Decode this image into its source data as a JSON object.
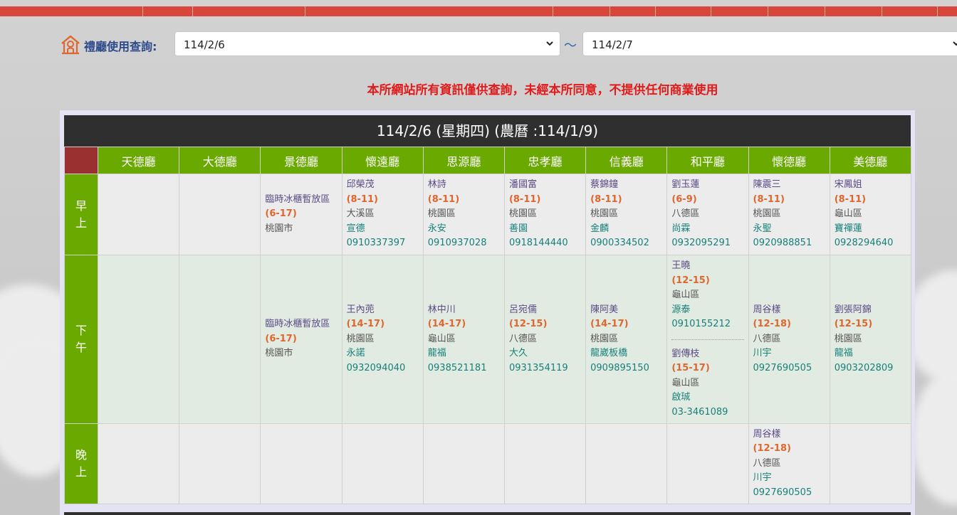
{
  "search": {
    "label": "禮廳使用查詢:",
    "start_date": "114/2/6",
    "end_date": "114/2/7",
    "separator": "〜"
  },
  "notice": "本所網站所有資訊僅供查詢，未經本所同意，不提供任何商業使用",
  "day": {
    "title": "114/2/6 (星期四) (農曆 :114/1/9)",
    "halls": [
      "天德廳",
      "大德廳",
      "景德廳",
      "懷遠廳",
      "思源廳",
      "忠孝廳",
      "信義廳",
      "和平廳",
      "懷德廳",
      "美德廳"
    ],
    "periods": [
      {
        "label": "早上",
        "cells": [
          [],
          [],
          [
            {
              "name": "臨時冰櫃暫放區",
              "time": "(6-17)",
              "area": "桃園市",
              "op": "",
              "phone": ""
            }
          ],
          [
            {
              "name": "邱榮茂",
              "time": "(8-11)",
              "area": "大溪區",
              "op": "宣德",
              "phone": "0910337397"
            }
          ],
          [
            {
              "name": "林詩",
              "time": "(8-11)",
              "area": "桃園區",
              "op": "永安",
              "phone": "0910937028"
            }
          ],
          [
            {
              "name": "潘國富",
              "time": "(8-11)",
              "area": "桃園區",
              "op": "善園",
              "phone": "0918144440"
            }
          ],
          [
            {
              "name": "蔡錦鐘",
              "time": "(8-11)",
              "area": "桃園區",
              "op": "金麟",
              "phone": "0900334502"
            }
          ],
          [
            {
              "name": "劉玉蓮",
              "time": "(6-9)",
              "area": "八德區",
              "op": "尚霖",
              "phone": "0932095291"
            }
          ],
          [
            {
              "name": "陳震三",
              "time": "(8-11)",
              "area": "桃園區",
              "op": "永聖",
              "phone": "0920988851"
            }
          ],
          [
            {
              "name": "宋鳳姐",
              "time": "(8-11)",
              "area": "龜山區",
              "op": "寶禪蓮",
              "phone": "0928294640"
            }
          ]
        ]
      },
      {
        "label": "下午",
        "cells": [
          [],
          [],
          [
            {
              "name": "臨時冰櫃暫放區",
              "time": "(6-17)",
              "area": "桃園市",
              "op": "",
              "phone": ""
            }
          ],
          [
            {
              "name": "王內蔸",
              "time": "(14-17)",
              "area": "桃園區",
              "op": "永諾",
              "phone": "0932094040"
            }
          ],
          [
            {
              "name": "林中川",
              "time": "(14-17)",
              "area": "龜山區",
              "op": "龍福",
              "phone": "0938521181"
            }
          ],
          [
            {
              "name": "呂宛儒",
              "time": "(12-15)",
              "area": "八德區",
              "op": "大久",
              "phone": "0931354119"
            }
          ],
          [
            {
              "name": "陳阿美",
              "time": "(14-17)",
              "area": "桃園區",
              "op": "龍崴板橋",
              "phone": "0909895150"
            }
          ],
          [
            {
              "name": "王曉",
              "time": "(12-15)",
              "area": "龜山區",
              "op": "源泰",
              "phone": "0910155212"
            },
            {
              "name": "劉傳枝",
              "time": "(15-17)",
              "area": "龜山區",
              "op": "啟珹",
              "phone": "03-3461089"
            }
          ],
          [
            {
              "name": "周谷樣",
              "time": "(12-18)",
              "area": "八德區",
              "op": "川宇",
              "phone": "0927690505"
            }
          ],
          [
            {
              "name": "劉張阿錦",
              "time": "(12-15)",
              "area": "桃園區",
              "op": "龍福",
              "phone": "0903202809"
            }
          ]
        ]
      },
      {
        "label": "晚上",
        "cells": [
          [],
          [],
          [],
          [],
          [],
          [],
          [],
          [],
          [
            {
              "name": "周谷樣",
              "time": "(12-18)",
              "area": "八德區",
              "op": "川宇",
              "phone": "0927690505"
            }
          ],
          []
        ]
      }
    ]
  },
  "colors": {
    "accent_red": "#d9463b",
    "header_green": "#6aaa00",
    "time_orange": "#e0662d",
    "phone_teal": "#16807a",
    "notice_red": "#e21a1a"
  },
  "icons": {
    "search_icon": "memorial-hall-icon",
    "select_arrow": "chevron-down-icon"
  }
}
